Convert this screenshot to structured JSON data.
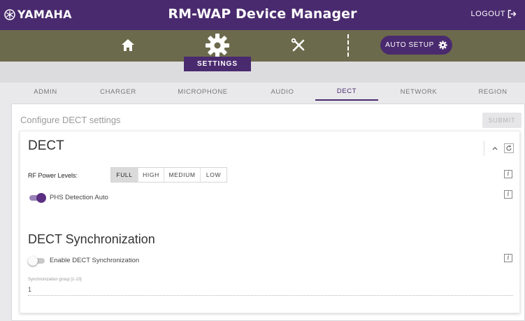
{
  "header": {
    "brand": "YAMAHA",
    "title": "RM-WAP Device Manager",
    "logout_label": "LOGOUT"
  },
  "nav": {
    "home_icon": "home-icon",
    "settings_icon": "gear-icon",
    "tools_icon": "tools-icon",
    "auto_setup_label": "AUTO SETUP",
    "active_section": "SETTINGS"
  },
  "tabs": [
    "ADMIN",
    "CHARGER",
    "MICROPHONE",
    "AUDIO",
    "DECT",
    "NETWORK",
    "REGION"
  ],
  "active_tab": "DECT",
  "panel": {
    "title": "Configure DECT settings",
    "submit_label": "SUBMIT"
  },
  "dect": {
    "title": "DECT",
    "rf_power_label": "RF Power Levels:",
    "rf_options": [
      "FULL",
      "HIGH",
      "MEDIUM",
      "LOW"
    ],
    "rf_selected": "FULL",
    "phs_label": "PHS Detection Auto",
    "phs_enabled": true
  },
  "sync": {
    "title": "DECT Synchronization",
    "enable_label": "Enable DECT Synchronization",
    "enabled": false,
    "group_label": "Synchronization group [1-10]",
    "group_value": "1"
  },
  "colors": {
    "header_purple": "#4a2a6e",
    "nav_olive": "#6c6a4c",
    "toggle_on": "#5a2f82"
  }
}
